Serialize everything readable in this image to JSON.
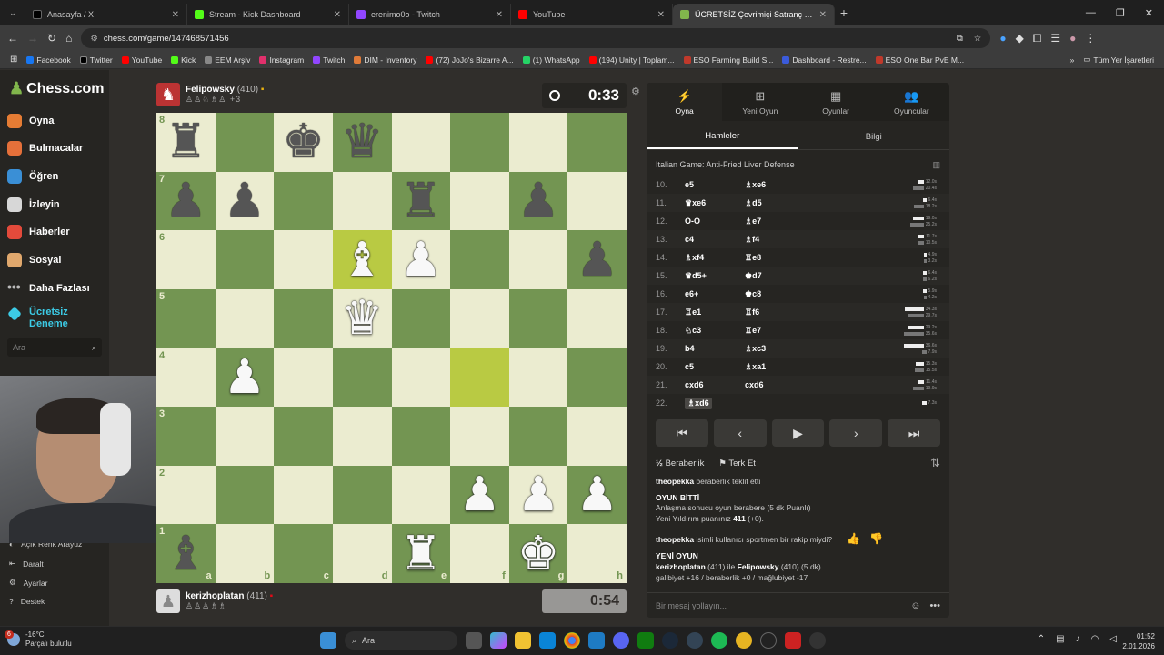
{
  "browser": {
    "tabs": [
      {
        "label": "Anasayfa / X",
        "color": "#000000",
        "active": false
      },
      {
        "label": "Stream - Kick Dashboard",
        "color": "#53fc18",
        "active": false
      },
      {
        "label": "erenimo0o - Twitch",
        "color": "#9146ff",
        "active": false
      },
      {
        "label": "YouTube",
        "color": "#ff0000",
        "active": false
      },
      {
        "label": "ÜCRETSİZ Çevrimiçi Satranç Oy",
        "color": "#81b64c",
        "active": true
      }
    ],
    "url": "chess.com/game/147468571456",
    "bookmarks": [
      {
        "label": "Facebook",
        "color": "#1877f2"
      },
      {
        "label": "Twitter",
        "color": "#000000"
      },
      {
        "label": "YouTube",
        "color": "#ff0000"
      },
      {
        "label": "Kick",
        "color": "#53fc18"
      },
      {
        "label": "EEM Arşiv",
        "color": "#888888"
      },
      {
        "label": "Instagram",
        "color": "#e1306c"
      },
      {
        "label": "Twitch",
        "color": "#9146ff"
      },
      {
        "label": "DIM - Inventory",
        "color": "#e07b39"
      },
      {
        "label": "(72) JoJo's Bizarre A...",
        "color": "#ff0000"
      },
      {
        "label": "(1) WhatsApp",
        "color": "#25d366"
      },
      {
        "label": "(194) Unity | Toplam...",
        "color": "#ff0000"
      },
      {
        "label": "ESO Farming Build S...",
        "color": "#c0392b"
      },
      {
        "label": "Dashboard - Restre...",
        "color": "#3b5bdb"
      },
      {
        "label": "ESO One Bar PvE M...",
        "color": "#c0392b"
      }
    ],
    "all_bookmarks": "Tüm Yer İşaretleri"
  },
  "sidebar": {
    "logo": "Chess.com",
    "items": [
      {
        "label": "Oyna",
        "color": "#e57c34"
      },
      {
        "label": "Bulmacalar",
        "color": "#e5703a"
      },
      {
        "label": "Öğren",
        "color": "#3a8fd6"
      },
      {
        "label": "İzleyin",
        "color": "#d7d7d7"
      },
      {
        "label": "Haberler",
        "color": "#e34a3b"
      },
      {
        "label": "Sosyal",
        "color": "#e0a86d"
      },
      {
        "label": "Daha Fazlası",
        "color": "#bbbbbb"
      },
      {
        "label": "Ücretsiz Deneme",
        "color": "#3ccbe6"
      }
    ],
    "search_placeholder": "Ara",
    "bottom": [
      {
        "label": "Açık Renk Arayüz"
      },
      {
        "label": "Daralt"
      },
      {
        "label": "Ayarlar"
      },
      {
        "label": "Destek"
      }
    ]
  },
  "top_player": {
    "name": "Felipowsky",
    "rating": "(410)",
    "captured": "♙♙♘♗♙ +3",
    "clock": "0:33"
  },
  "bottom_player": {
    "name": "kerizhoplatan",
    "rating": "(411)",
    "captured": "♙♙♙♗♗",
    "clock": "0:54"
  },
  "board": {
    "ranks": [
      "8",
      "7",
      "6",
      "5",
      "4",
      "3",
      "2",
      "1"
    ],
    "files": [
      "a",
      "b",
      "c",
      "d",
      "e",
      "f",
      "g",
      "h"
    ],
    "rows": [
      [
        "br",
        "",
        "bk",
        "bq",
        "",
        "",
        "",
        ""
      ],
      [
        "bp",
        "bp",
        "",
        "",
        "br",
        "",
        "bp",
        ""
      ],
      [
        "",
        "",
        "",
        "wb",
        "wp",
        "",
        "",
        "bp"
      ],
      [
        "",
        "",
        "",
        "wq",
        "",
        "",
        "",
        ""
      ],
      [
        "",
        "wp",
        "",
        "",
        "",
        "",
        "",
        ""
      ],
      [
        "",
        "",
        "",
        "",
        "",
        "",
        "",
        ""
      ],
      [
        "",
        "",
        "",
        "",
        "",
        "wp",
        "wp",
        "wp"
      ],
      [
        "bb",
        "",
        "",
        "",
        "wr",
        "",
        "wk",
        ""
      ]
    ],
    "highlight": [
      [
        2,
        3
      ],
      [
        4,
        5
      ]
    ]
  },
  "panel": {
    "tabs": [
      {
        "label": "Oyna",
        "icon": "⚡"
      },
      {
        "label": "Yeni Oyun",
        "icon": "⊞"
      },
      {
        "label": "Oyunlar",
        "icon": "▦"
      },
      {
        "label": "Oyuncular",
        "icon": "👥"
      }
    ],
    "subtabs": [
      "Hamleler",
      "Bilgi"
    ],
    "opening": "Italian Game: Anti-Fried Liver Defense",
    "moves": [
      {
        "n": "10.",
        "w": "e5",
        "b": "♗xe6",
        "tw": "12.0s",
        "tb": "20.4s"
      },
      {
        "n": "11.",
        "w": "♛xe6",
        "b": "♗d5",
        "tw": "6.4s",
        "tb": "18.2s"
      },
      {
        "n": "12.",
        "w": "O-O",
        "b": "♗e7",
        "tw": "19.0s",
        "tb": "25.2s"
      },
      {
        "n": "13.",
        "w": "c4",
        "b": "♗f4",
        "tw": "11.7s",
        "tb": "10.5s"
      },
      {
        "n": "14.",
        "w": "♗xf4",
        "b": "♖e8",
        "tw": "4.9s",
        "tb": "3.2s"
      },
      {
        "n": "15.",
        "w": "♛d5+",
        "b": "♚d7",
        "tw": "6.4s",
        "tb": "6.2s"
      },
      {
        "n": "16.",
        "w": "e6+",
        "b": "♚c8",
        "tw": "5.9s",
        "tb": "4.2s"
      },
      {
        "n": "17.",
        "w": "♖e1",
        "b": "♖f6",
        "tw": "34.3s",
        "tb": "29.7s"
      },
      {
        "n": "18.",
        "w": "♘c3",
        "b": "♖e7",
        "tw": "29.2s",
        "tb": "35.6s"
      },
      {
        "n": "19.",
        "w": "b4",
        "b": "♗xc3",
        "tw": "36.6s",
        "tb": "7.9s"
      },
      {
        "n": "20.",
        "w": "c5",
        "b": "♗xa1",
        "tw": "15.3s",
        "tb": "15.5s"
      },
      {
        "n": "21.",
        "w": "cxd6",
        "b": "cxd6",
        "tw": "11.4s",
        "tb": "19.9s"
      },
      {
        "n": "22.",
        "w": "♗xd6",
        "b": "",
        "tw": "7.3s",
        "tb": ""
      }
    ],
    "actions": {
      "draw": "Beraberlik",
      "resign": "Terk Et"
    },
    "chat": {
      "offer_user": "theopekka",
      "offer_text": "beraberlik teklif etti",
      "game_over": "OYUN BİTTİ",
      "result_text": "Anlaşma sonucu oyun berabere (5 dk Puanlı)",
      "new_rating_label": "Yeni Yıldırım puanınız",
      "new_rating": "411",
      "new_rating_delta": "(+0).",
      "question_user": "theopekka",
      "question_text": "isimli kullanıcı sportmen bir rakip miydi?",
      "new_game": "YENİ OYUN",
      "p1": "kerizhoplatan",
      "p1r": "(411) ile",
      "p2": "Felipowsky",
      "p2r": "(410) (5 dk)",
      "stats": "galibiyet +16 / beraberlik +0 / mağlubiyet -17"
    },
    "message_placeholder": "Bir mesaj yollayın..."
  },
  "taskbar": {
    "temp": "-16°C",
    "weather": "Parçalı bulutlu",
    "badge": "6",
    "search": "Ara",
    "time": "01:52",
    "date": "2.01.2026"
  }
}
